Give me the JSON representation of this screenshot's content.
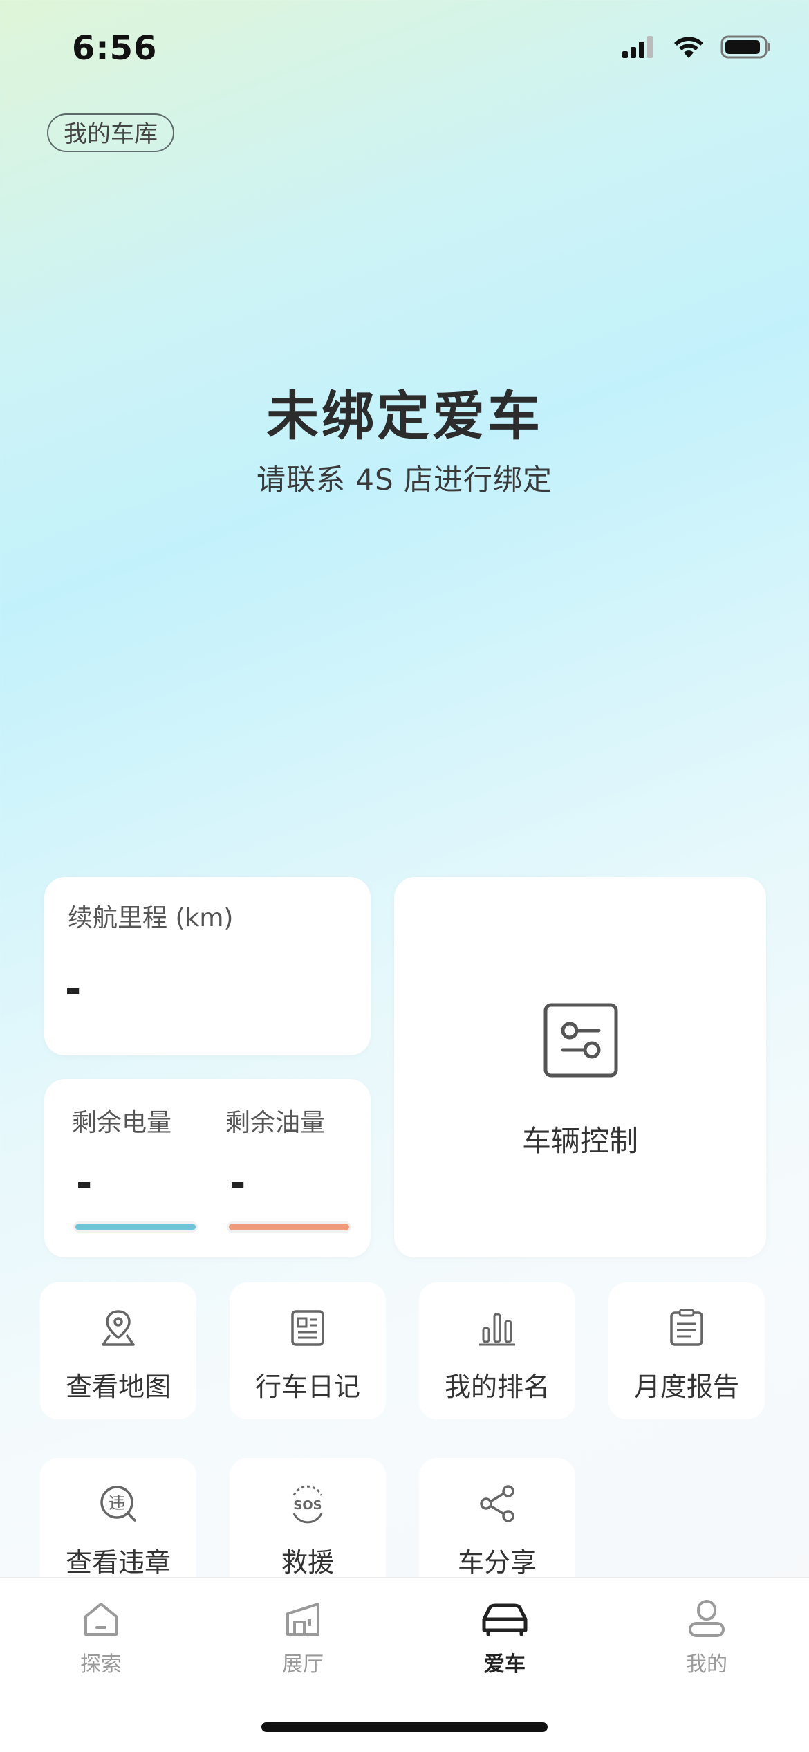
{
  "status_bar": {
    "time": "6:56",
    "battery_level": 0.8
  },
  "garage_chip": "我的车库",
  "hero": {
    "title": "未绑定爱车",
    "subtitle": "请联系 4S 店进行绑定"
  },
  "range_card": {
    "label": "续航里程 (km)",
    "value": "-"
  },
  "energy_card": {
    "battery": {
      "label": "剩余电量",
      "value": "-",
      "color": "#6fc5d8"
    },
    "fuel": {
      "label": "剩余油量",
      "value": "-",
      "color": "#ef9a78"
    }
  },
  "control_card": {
    "label": "车辆控制",
    "icon": "sliders-icon"
  },
  "features_row1": [
    {
      "label": "查看地图",
      "icon": "map-pin-icon"
    },
    {
      "label": "行车日记",
      "icon": "journal-icon"
    },
    {
      "label": "我的排名",
      "icon": "bar-chart-icon"
    },
    {
      "label": "月度报告",
      "icon": "clipboard-icon"
    }
  ],
  "features_row2": [
    {
      "label": "查看违章",
      "icon": "violation-icon",
      "glyph": "违"
    },
    {
      "label": "救援",
      "icon": "sos-icon",
      "glyph": "SOS"
    },
    {
      "label": "车分享",
      "icon": "share-icon"
    }
  ],
  "tabbar": {
    "items": [
      {
        "label": "探索",
        "icon": "home-icon",
        "active": false
      },
      {
        "label": "展厅",
        "icon": "showroom-icon",
        "active": false
      },
      {
        "label": "爱车",
        "icon": "car-icon",
        "active": true
      },
      {
        "label": "我的",
        "icon": "profile-icon",
        "active": false
      }
    ],
    "active_color": "#222222",
    "inactive_color": "#9a9a9a"
  }
}
